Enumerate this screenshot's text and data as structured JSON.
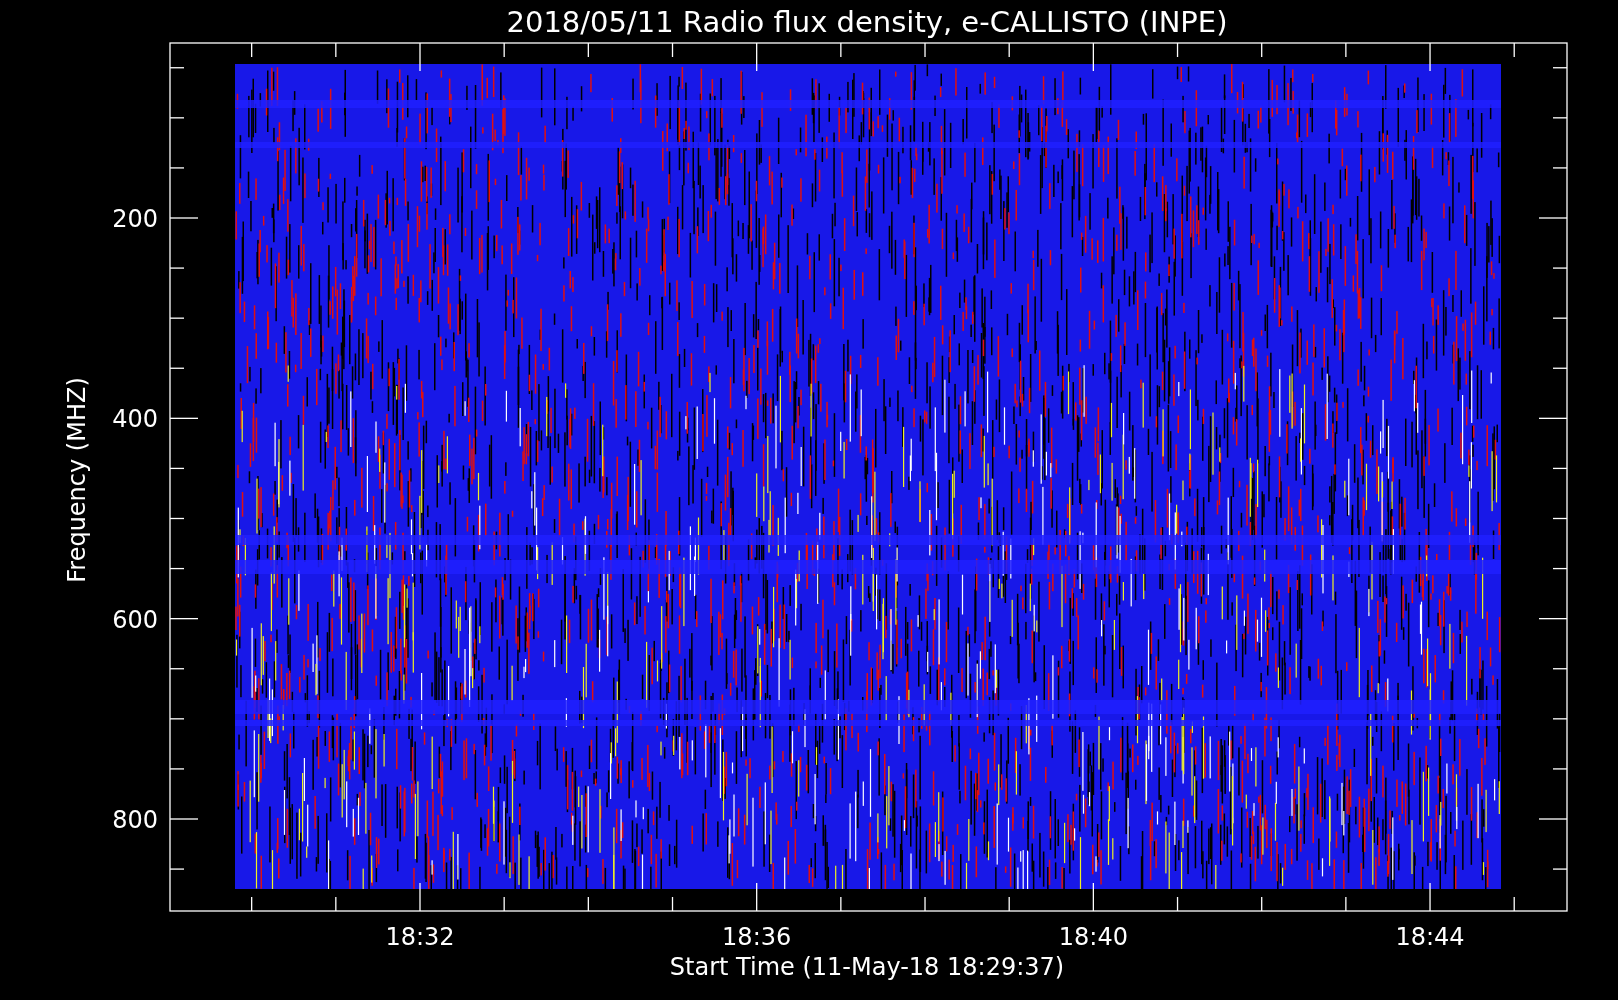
{
  "plot": {
    "title": "2018/05/11  Radio flux density, e-CALLISTO (INPE)",
    "ylabel": "Frequency (MHZ)",
    "xlabel": "Start Time (11-May-18 18:29:37)",
    "yticks": [
      "200",
      "400",
      "600",
      "800"
    ],
    "xticks": [
      "18:32",
      "18:36",
      "18:40",
      "18:44"
    ]
  }
}
